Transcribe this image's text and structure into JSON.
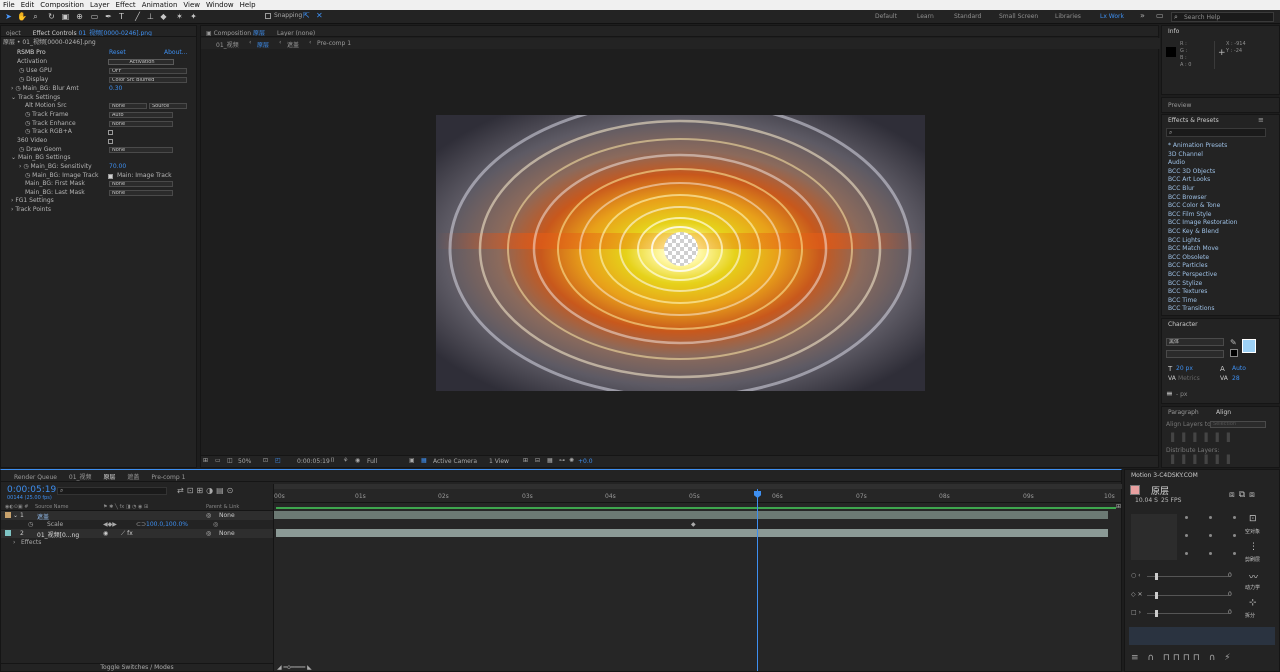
{
  "menu": [
    "File",
    "Edit",
    "Composition",
    "Layer",
    "Effect",
    "Animation",
    "View",
    "Window",
    "Help"
  ],
  "toolbar": {
    "snapping": "Snapping",
    "search_placeholder": "Search Help"
  },
  "workspaces": [
    "Default",
    "Learn",
    "Standard",
    "Small Screen",
    "Libraries",
    "Lx Work"
  ],
  "effect_controls": {
    "tab_left": "oject",
    "tab": "Effect Controls",
    "tab_file": "01_视频[0000-0246].png",
    "breadcrumb": "原层 • 01_视频[0000-0246].png",
    "effect_name": "RSMB Pro",
    "reset": "Reset",
    "about": "About...",
    "rows": [
      {
        "label": "Activation",
        "value": "Activation"
      },
      {
        "label": "Use GPU",
        "value": "OFF"
      },
      {
        "label": "Display",
        "value": "Color Src Blurred"
      },
      {
        "label": "Main_BG: Blur Amt",
        "value": "0.30"
      },
      {
        "label": "Track Settings",
        "value": ""
      },
      {
        "label": "Alt Motion Src",
        "value": "None",
        "value2": "Source"
      },
      {
        "label": "Track Frame",
        "value": "Auto"
      },
      {
        "label": "Track Enhance",
        "value": "None"
      },
      {
        "label": "Track RGB+A",
        "value": ""
      },
      {
        "label": "360 Video",
        "value": ""
      },
      {
        "label": "Draw Geom",
        "value": "None"
      },
      {
        "label": "Main_BG Settings",
        "value": ""
      },
      {
        "label": "Main_BG: Sensitivity",
        "value": "70.00"
      },
      {
        "label": "Main_BG: Image Track",
        "value": "Main: Image Track"
      },
      {
        "label": "Main_BG: First Mask",
        "value": "None"
      },
      {
        "label": "Main_BG: Last Mask",
        "value": "None"
      },
      {
        "label": "FG1 Settings",
        "value": ""
      },
      {
        "label": "Track Points",
        "value": ""
      }
    ]
  },
  "composition": {
    "tab": "Composition",
    "comp_name": "原层",
    "layer_tab": "Layer (none)",
    "flow": [
      "01_视频",
      "原层",
      "遮盖",
      "Pre-comp 1"
    ],
    "zoom": "50%",
    "timecode": "0:00:05:19",
    "resolution": "Full",
    "camera": "Active Camera",
    "views": "1 View",
    "exposure": "+0.0"
  },
  "info": {
    "title": "Info",
    "channels": [
      "R :",
      "G :",
      "B :",
      "A : 0"
    ],
    "x": "X : -914",
    "y": "Y : -24"
  },
  "right_panels": {
    "preview": "Preview",
    "effects_presets": "Effects & Presets",
    "fx_list": [
      "* Animation Presets",
      "3D Channel",
      "Audio",
      "BCC 3D Objects",
      "BCC Art Looks",
      "BCC Blur",
      "BCC Browser",
      "BCC Color & Tone",
      "BCC Film Style",
      "BCC Image Restoration",
      "BCC Key & Blend",
      "BCC Lights",
      "BCC Match Move",
      "BCC Obsolete",
      "BCC Particles",
      "BCC Perspective",
      "BCC Stylize",
      "BCC Textures",
      "BCC Time",
      "BCC Transitions"
    ],
    "character": "Character",
    "font": "黑体",
    "font_size": "20 px",
    "leading": "Auto",
    "metrics": "Metrics",
    "tracking": "28",
    "px": "- px",
    "paragraph": "Paragraph",
    "align": "Align",
    "align_layers_to": "Align Layers to:",
    "selection": "Selection",
    "distribute_layers": "Distribute Layers:"
  },
  "timeline": {
    "tabs": [
      "Render Queue",
      "01_视频",
      "原层",
      "遮盖",
      "Pre-comp 1"
    ],
    "timecode": "0:00:05:19",
    "frames": "00144 (25.00 fps)",
    "ruler": [
      "00s",
      "01s",
      "02s",
      "03s",
      "04s",
      "05s",
      "06s",
      "07s",
      "08s",
      "09s",
      "10s"
    ],
    "playhead_fraction": 0.579,
    "columns": {
      "source": "Source Name",
      "parent": "Parent & Link"
    },
    "layers": [
      {
        "num": "1",
        "name": "遮盖",
        "parent": "None",
        "color": "#c8a26c"
      },
      {
        "num": "",
        "name": "Scale",
        "parent": "",
        "value": "100.0,100.0%",
        "color": ""
      },
      {
        "num": "2",
        "name": "01_视频[0...ng",
        "parent": "None",
        "color": "#7ec4c4"
      },
      {
        "num": "",
        "name": "Effects",
        "parent": "",
        "value": "",
        "color": ""
      }
    ],
    "toggle": "Toggle Switches / Modes"
  },
  "motion3": {
    "title": "Motion 3-C4DSKY.COM",
    "layer": "原层",
    "duration": "10.04 S",
    "fps": "25 FPS",
    "sliders": [
      "0",
      "0",
      "0"
    ],
    "buttons": [
      "空对象",
      "剪刷层",
      "动力学",
      "拆分"
    ]
  }
}
